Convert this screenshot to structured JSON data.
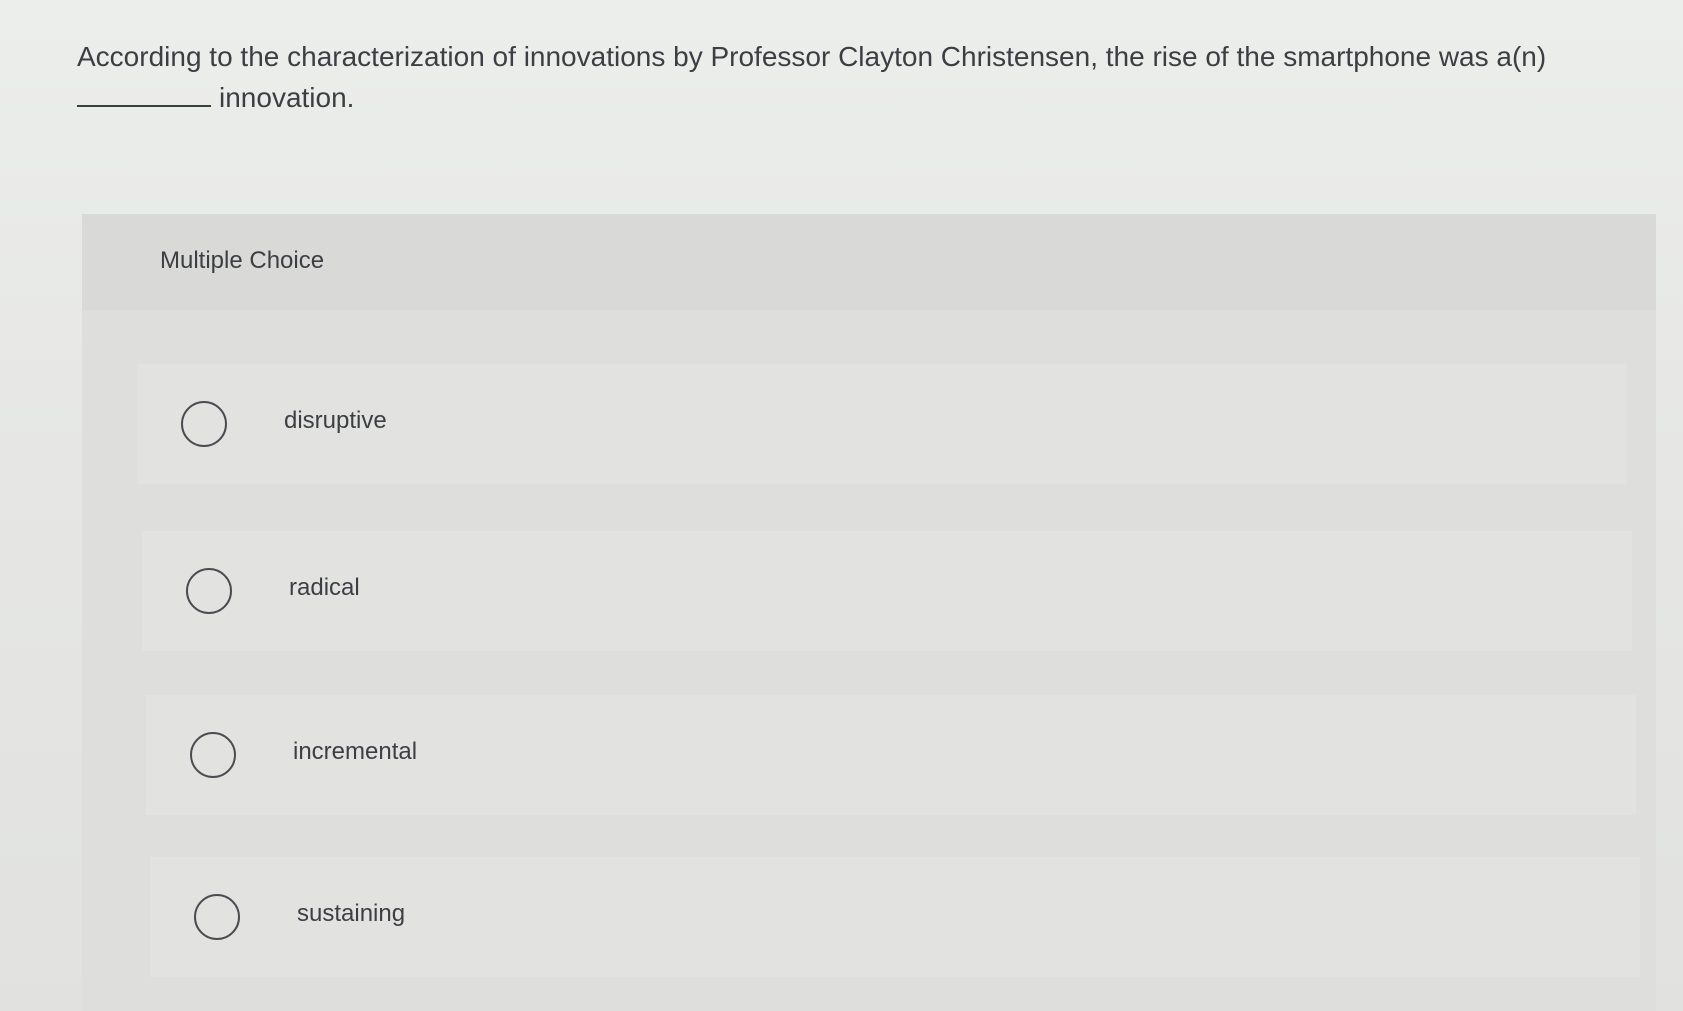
{
  "question": {
    "text_line1": "According to the characterization of innovations by Professor Clayton Christensen, the rise of the smartphone was a(n)",
    "text_line2": "innovation."
  },
  "multiple_choice": {
    "title": "Multiple Choice",
    "options": [
      {
        "label": "disruptive",
        "selected": false
      },
      {
        "label": "radical",
        "selected": false
      },
      {
        "label": "incremental",
        "selected": false
      },
      {
        "label": "sustaining",
        "selected": false
      }
    ]
  }
}
